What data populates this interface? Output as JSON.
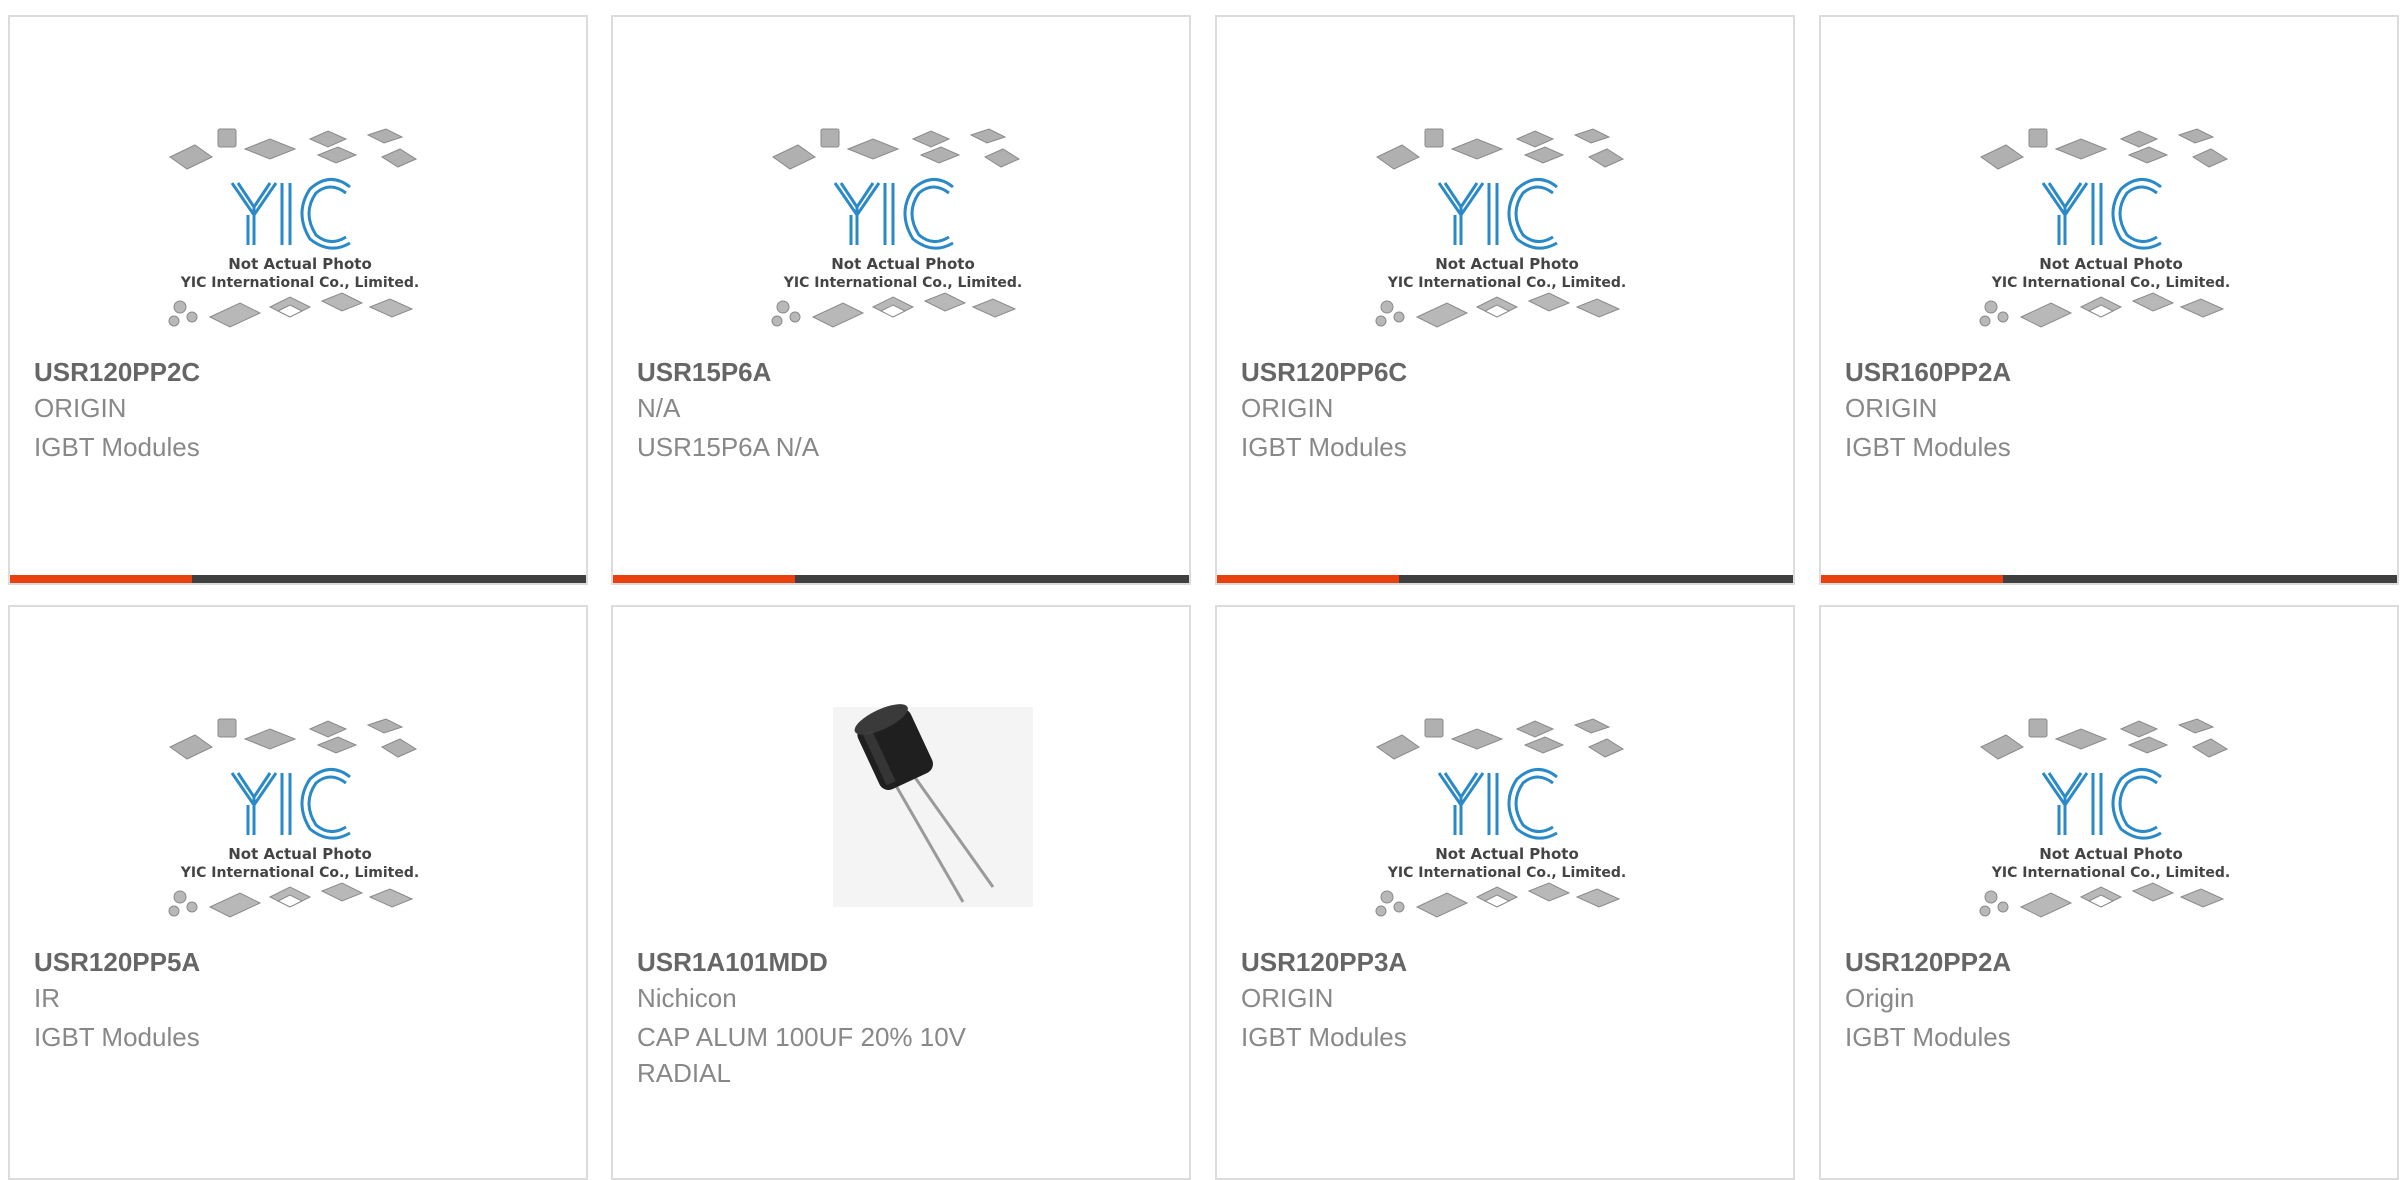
{
  "colors": {
    "accent": "#e8410f",
    "bar": "#3f3f3f",
    "brand_blue": "#2a8ac8"
  },
  "placeholder": {
    "logo": "YIC",
    "line1": "Not Actual Photo",
    "line2": "YIC International Co., Limited."
  },
  "products": [
    {
      "part_number": "USR120PP2C",
      "manufacturer": "ORIGIN",
      "description": "IGBT Modules",
      "image": "placeholder-image"
    },
    {
      "part_number": "USR15P6A",
      "manufacturer": "N/A",
      "description": "USR15P6A N/A",
      "image": "placeholder-image"
    },
    {
      "part_number": "USR120PP6C",
      "manufacturer": "ORIGIN",
      "description": "IGBT Modules",
      "image": "placeholder-image"
    },
    {
      "part_number": "USR160PP2A",
      "manufacturer": "ORIGIN",
      "description": "IGBT Modules",
      "image": "placeholder-image"
    },
    {
      "part_number": "USR120PP5A",
      "manufacturer": "IR",
      "description": "IGBT Modules",
      "image": "placeholder-image"
    },
    {
      "part_number": "USR1A101MDD",
      "manufacturer": "Nichicon",
      "description": "CAP ALUM 100UF 20% 10V RADIAL",
      "image": "capacitor-photo"
    },
    {
      "part_number": "USR120PP3A",
      "manufacturer": "ORIGIN",
      "description": "IGBT Modules",
      "image": "placeholder-image"
    },
    {
      "part_number": "USR120PP2A",
      "manufacturer": "Origin",
      "description": "IGBT Modules",
      "image": "placeholder-image"
    }
  ]
}
